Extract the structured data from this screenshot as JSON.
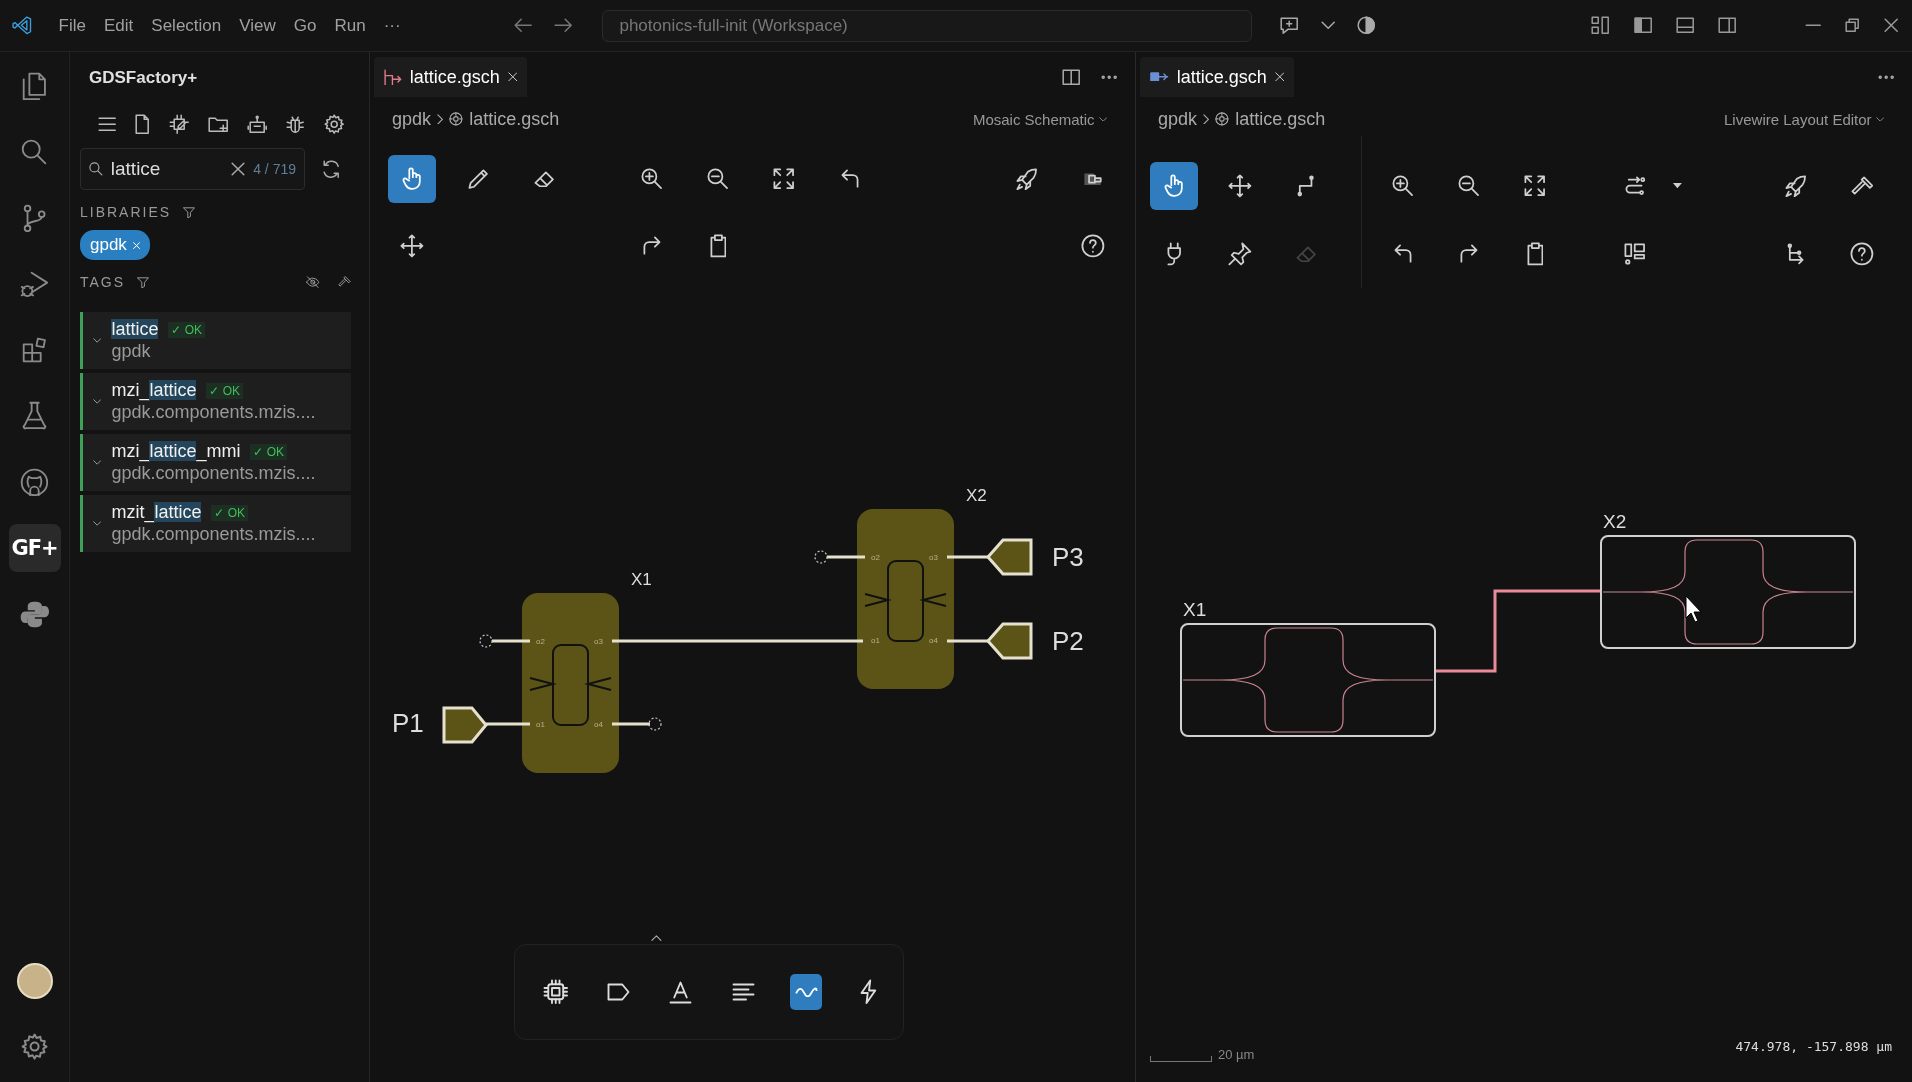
{
  "title_bar": {
    "menu": [
      "File",
      "Edit",
      "Selection",
      "View",
      "Go",
      "Run",
      "···"
    ],
    "search": "photonics-full-init (Workspace)"
  },
  "activity_bar": {
    "items": [
      {
        "kind": "files",
        "selected": false
      },
      {
        "kind": "search",
        "selected": false
      },
      {
        "kind": "source-control",
        "selected": false
      },
      {
        "kind": "run-debug",
        "selected": false
      },
      {
        "kind": "extensions",
        "selected": false
      },
      {
        "kind": "flask",
        "selected": false
      },
      {
        "kind": "cat",
        "selected": false
      },
      {
        "kind": "text",
        "label": "GF+",
        "selected": true
      },
      {
        "kind": "snakes",
        "selected": false
      }
    ]
  },
  "sidebar": {
    "title": "GDSFactory+",
    "search": {
      "value": "lattice",
      "count": "4 / 719"
    },
    "libraries_heading": "LIBRARIES",
    "libraries": [
      {
        "label": "gpdk"
      }
    ],
    "tags_heading": "TAGS",
    "components": [
      {
        "name_parts": [
          {
            "text": "lattice",
            "match": true
          }
        ],
        "status": "✓ OK",
        "path": "gpdk"
      },
      {
        "name_parts": [
          {
            "text": "mzi_",
            "match": false
          },
          {
            "text": "lattice",
            "match": true
          }
        ],
        "status": "✓ OK",
        "path": "gpdk.components.mzis...."
      },
      {
        "name_parts": [
          {
            "text": "mzi_",
            "match": false
          },
          {
            "text": "lattice",
            "match": true
          },
          {
            "text": "_mmi",
            "match": false
          }
        ],
        "status": "✓ OK",
        "path": "gpdk.components.mzis...."
      },
      {
        "name_parts": [
          {
            "text": "mzit_",
            "match": false
          },
          {
            "text": "lattice",
            "match": true
          }
        ],
        "status": "✓ OK",
        "path": "gpdk.components.mzis...."
      }
    ]
  },
  "editors": [
    {
      "tabs": [
        {
          "label": "lattice.gsch",
          "kind": "schematic",
          "selected": true
        }
      ],
      "breadcrumb": [
        "gpdk",
        "lattice.gsch"
      ],
      "mode": "Mosaic Schematic",
      "toolbar": [
        [
          [
            {
              "kind": "hand",
              "selected": true,
              "disabled": false
            },
            {
              "kind": "pencil",
              "selected": false,
              "disabled": false
            },
            {
              "kind": "eraser",
              "selected": false,
              "disabled": false
            }
          ],
          [
            {
              "kind": "zoom-in",
              "selected": false,
              "disabled": false
            },
            {
              "kind": "zoom-out",
              "selected": false,
              "disabled": false
            },
            {
              "kind": "fit",
              "selected": false,
              "disabled": false
            },
            {
              "kind": "undo",
              "selected": false,
              "disabled": false
            }
          ],
          [
            {
              "kind": "rocket",
              "selected": false,
              "disabled": false
            },
            {
              "kind": "block",
              "selected": false,
              "disabled": false
            }
          ]
        ],
        [
          [
            {
              "kind": "move",
              "selected": false,
              "disabled": false
            }
          ],
          [
            {
              "kind": "redo",
              "selected": false,
              "disabled": false
            },
            {
              "kind": "clipboard",
              "selected": false,
              "disabled": false
            }
          ],
          [
            {
              "kind": "help",
              "selected": false,
              "disabled": false
            }
          ]
        ]
      ],
      "canvas": {
        "kind": "schematic",
        "instances": [
          {
            "label": "X1",
            "ports": [
              "o2",
              "o3",
              "o1",
              "o4"
            ]
          },
          {
            "label": "X2",
            "ports": [
              "o2",
              "o3",
              "o1",
              "o4"
            ]
          }
        ],
        "pins": [
          {
            "label": "P1"
          },
          {
            "label": "P3"
          },
          {
            "label": "P2"
          }
        ]
      },
      "palette": [
        {
          "kind": "chip",
          "selected": false
        },
        {
          "kind": "tag",
          "selected": false
        },
        {
          "kind": "text-tool",
          "selected": false
        },
        {
          "kind": "align",
          "selected": false
        },
        {
          "kind": "wave",
          "selected": true
        },
        {
          "kind": "bolt",
          "selected": false
        }
      ]
    },
    {
      "tabs": [
        {
          "label": "lattice.gsch",
          "kind": "layout",
          "selected": true
        }
      ],
      "breadcrumb": [
        "gpdk",
        "lattice.gsch"
      ],
      "mode": "Livewire Layout Editor",
      "toolbar": [
        [
          [
            {
              "kind": "hand",
              "selected": true,
              "disabled": false
            },
            {
              "kind": "move",
              "selected": false,
              "disabled": false
            },
            {
              "kind": "route",
              "selected": false,
              "disabled": false
            }
          ],
          [
            {
              "kind": "zoom-in",
              "selected": false,
              "disabled": false
            },
            {
              "kind": "zoom-out",
              "selected": false,
              "disabled": false
            },
            {
              "kind": "fit",
              "selected": false,
              "disabled": false
            }
          ],
          [
            {
              "kind": "route-options",
              "selected": false,
              "disabled": false
            },
            {
              "kind": "dropdown",
              "selected": false,
              "disabled": false
            }
          ],
          [
            {
              "kind": "rocket",
              "selected": false,
              "disabled": false
            },
            {
              "kind": "hammer",
              "selected": false,
              "disabled": false
            }
          ]
        ],
        [
          [
            {
              "kind": "plug",
              "selected": false,
              "disabled": false
            },
            {
              "kind": "pin",
              "selected": false,
              "disabled": false
            },
            {
              "kind": "eraser",
              "selected": false,
              "disabled": true
            }
          ],
          [
            {
              "kind": "undo",
              "selected": false,
              "disabled": false
            },
            {
              "kind": "redo",
              "selected": false,
              "disabled": false
            },
            {
              "kind": "clipboard",
              "selected": false,
              "disabled": false
            }
          ],
          [
            {
              "kind": "layout-grid",
              "selected": false,
              "disabled": false
            }
          ],
          [
            {
              "kind": "route-branch",
              "selected": false,
              "disabled": false
            },
            {
              "kind": "help",
              "selected": false,
              "disabled": false
            }
          ]
        ]
      ],
      "canvas": {
        "kind": "layout",
        "cells": [
          {
            "label": "X1"
          },
          {
            "label": "X2"
          }
        ],
        "scale": "20 µm",
        "cursor_position": "474.978, -157.898 µm"
      }
    }
  ]
}
